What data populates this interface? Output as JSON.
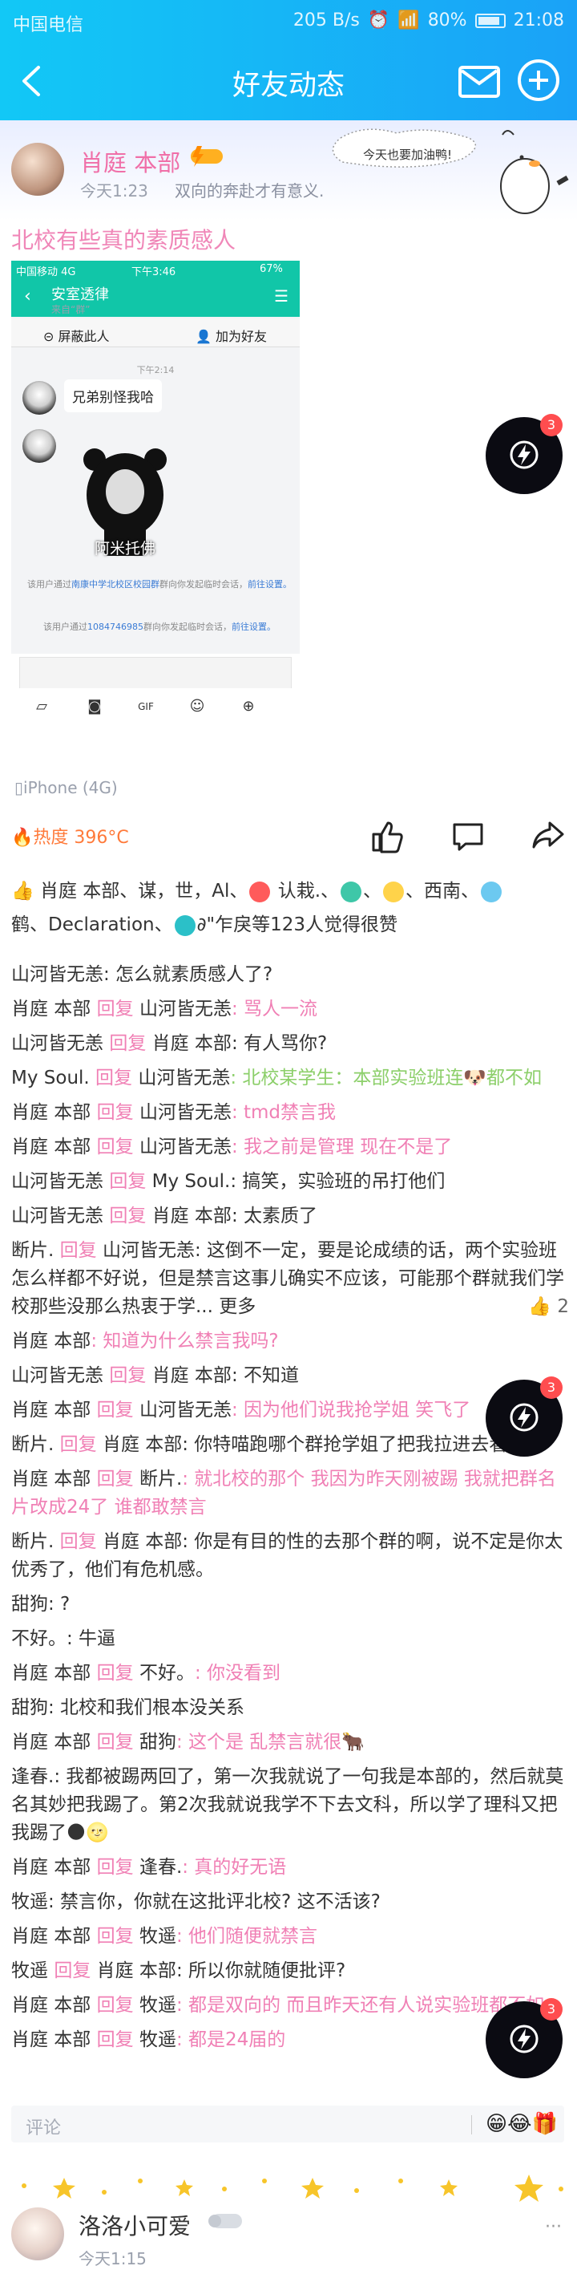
{
  "status_bar": {
    "carrier": "中国电信",
    "speed": "205 B/s",
    "battery": "80%",
    "time": "21:08"
  },
  "nav": {
    "title": "好友动态"
  },
  "post": {
    "author": "肖庭 本部",
    "time": "今天1:23",
    "signature": "双向的奔赴才有意义.",
    "banner_text": "今天也要加油鸭!",
    "text": "北校有些真的素质感人",
    "device": "iPhone (4G)",
    "heat": "热度 396°C"
  },
  "screenshot": {
    "carrier": "中国移动 4G",
    "time": "下午3:46",
    "battery": "67%",
    "title": "安室透律",
    "subtitle": "来自“群”",
    "block": "屏蔽此人",
    "add_friend": "加为好友",
    "msg_time": "下午2:14",
    "msg": "兄弟别怪我哈",
    "meme_caption": "阿米托佛",
    "sys1_a": "该用户通过",
    "sys1_b": "南康中学北校区校园群",
    "sys1_c": "群向你发起临时会话，",
    "sys1_d": "前往设置。",
    "sys2_a": "该用户通过",
    "sys2_b": "1084746985",
    "sys2_c": "群向你发起临时会话，",
    "sys2_d": "前往设置。"
  },
  "likes": {
    "text1": "肖庭 本部、谋，世，Al、",
    "text2": " 认栽.、",
    "text3": "、",
    "text4": "、西南、",
    "text5": "鹤、Declaration、",
    "text6": "∂\"乍戾等123人觉得很赞"
  },
  "comments": [
    {
      "a": "山河皆无恙",
      "b": "",
      "c": "",
      "t": ": 怎么就素质感人了?",
      "tc": "n"
    },
    {
      "a": "肖庭 本部",
      "b": "回复",
      "c": "山河皆无恙",
      "t": ": 骂人一流",
      "tc": "pk"
    },
    {
      "a": "山河皆无恙",
      "b": "回复",
      "c": "肖庭 本部",
      "t": ": 有人骂你?",
      "tc": "n"
    },
    {
      "a": "My Soul.",
      "b": "回复",
      "c": "山河皆无恙",
      "t": ": 北校某学生：本部实验班连🐶都不如",
      "tc": "gr"
    },
    {
      "a": "肖庭 本部",
      "b": "回复",
      "c": "山河皆无恙",
      "t": ": tmd禁言我",
      "tc": "pk"
    },
    {
      "a": "肖庭 本部",
      "b": "回复",
      "c": "山河皆无恙",
      "t": ": 我之前是管理 现在不是了",
      "tc": "pk"
    },
    {
      "a": "山河皆无恙",
      "b": "回复",
      "c": "My Soul.",
      "t": ": 搞笑，实验班的吊打他们",
      "tc": "n"
    },
    {
      "a": "山河皆无恙",
      "b": "回复",
      "c": "肖庭 本部",
      "t": ": 太素质了",
      "tc": "n"
    },
    {
      "a": "断片.",
      "b": "回复",
      "c": "山河皆无恙",
      "t": ": 这倒不一定，要是论成绩的话，两个实验班怎么样都不好说，但是禁言这事儿确实不应该，可能那个群就我们学校那些没那么热衷于学... 更多",
      "tc": "n",
      "wrap": true,
      "like": "2"
    },
    {
      "a": "肖庭 本部",
      "b": "",
      "c": "",
      "t": ": 知道为什么禁言我吗?",
      "tc": "pk"
    },
    {
      "a": "山河皆无恙",
      "b": "回复",
      "c": "肖庭 本部",
      "t": ": 不知道",
      "tc": "n"
    },
    {
      "a": "肖庭 本部",
      "b": "回复",
      "c": "山河皆无恙",
      "t": ": 因为他们说我抢学姐 笑飞了",
      "tc": "pk"
    },
    {
      "a": "断片.",
      "b": "回复",
      "c": "肖庭 本部",
      "t": ": 你特喵跑哪个群抢学姐了把我拉进去看看😏",
      "tc": "n",
      "wrap": true
    },
    {
      "a": "肖庭 本部",
      "b": "回复",
      "c": "断片.",
      "t": ": 就北校的那个 我因为昨天刚被踢 我就把群名片改成24了 谁都敢禁言",
      "tc": "pk",
      "wrap": true
    },
    {
      "a": "断片.",
      "b": "回复",
      "c": "肖庭 本部",
      "t": ": 你是有目的性的去那个群的啊，说不定是你太优秀了，他们有危机感。",
      "tc": "n",
      "wrap": true
    },
    {
      "a": "甜狗",
      "b": "",
      "c": "",
      "t": ": ?",
      "tc": "n"
    },
    {
      "a": "不好。",
      "b": "",
      "c": "",
      "t": ": 牛逼",
      "tc": "n"
    },
    {
      "a": "肖庭 本部",
      "b": "回复",
      "c": "不好。",
      "t": ": 你没看到",
      "tc": "pk"
    },
    {
      "a": "甜狗",
      "b": "",
      "c": "",
      "t": ": 北校和我们根本没关系",
      "tc": "n"
    },
    {
      "a": "肖庭 本部",
      "b": "回复",
      "c": "甜狗",
      "t": ": 这个是 乱禁言就很🐂",
      "tc": "pk"
    },
    {
      "a": "逢春.",
      "b": "",
      "c": "",
      "t": ": 我都被踢两回了，第一次我就说了一句我是本部的，然后就莫名其妙把我踢了。第2次我就说我学不下去文科，所以学了理科又把我踢了🌑🌝",
      "tc": "n",
      "wrap": true
    },
    {
      "a": "肖庭 本部",
      "b": "回复",
      "c": "逢春.",
      "t": ": 真的好无语",
      "tc": "pk"
    },
    {
      "a": "牧遥",
      "b": "",
      "c": "",
      "t": ": 禁言你，你就在这批评北校? 这不活该?",
      "tc": "n"
    },
    {
      "a": "肖庭 本部",
      "b": "回复",
      "c": "牧遥",
      "t": ": 他们随便就禁言",
      "tc": "pk"
    },
    {
      "a": "牧遥",
      "b": "回复",
      "c": "肖庭 本部",
      "t": ": 所以你就随便批评?",
      "tc": "n"
    },
    {
      "a": "肖庭 本部",
      "b": "回复",
      "c": "牧遥",
      "t": ": 都是双向的 而且昨天还有人说实验班都不如",
      "tc": "pk",
      "wrap": true
    },
    {
      "a": "肖庭 本部",
      "b": "回复",
      "c": "牧遥",
      "t": ": 都是24届的",
      "tc": "pk"
    }
  ],
  "comment_box": {
    "placeholder": "评论",
    "emojis": "😁😂🎁"
  },
  "floating_badge": "3",
  "next_post": {
    "author": "洛洛小可爱",
    "time": "今天1:15",
    "more": "···"
  },
  "colors": {
    "accent": "#16b6f7",
    "pink": "#f080b5",
    "green": "#8ccf6a"
  }
}
